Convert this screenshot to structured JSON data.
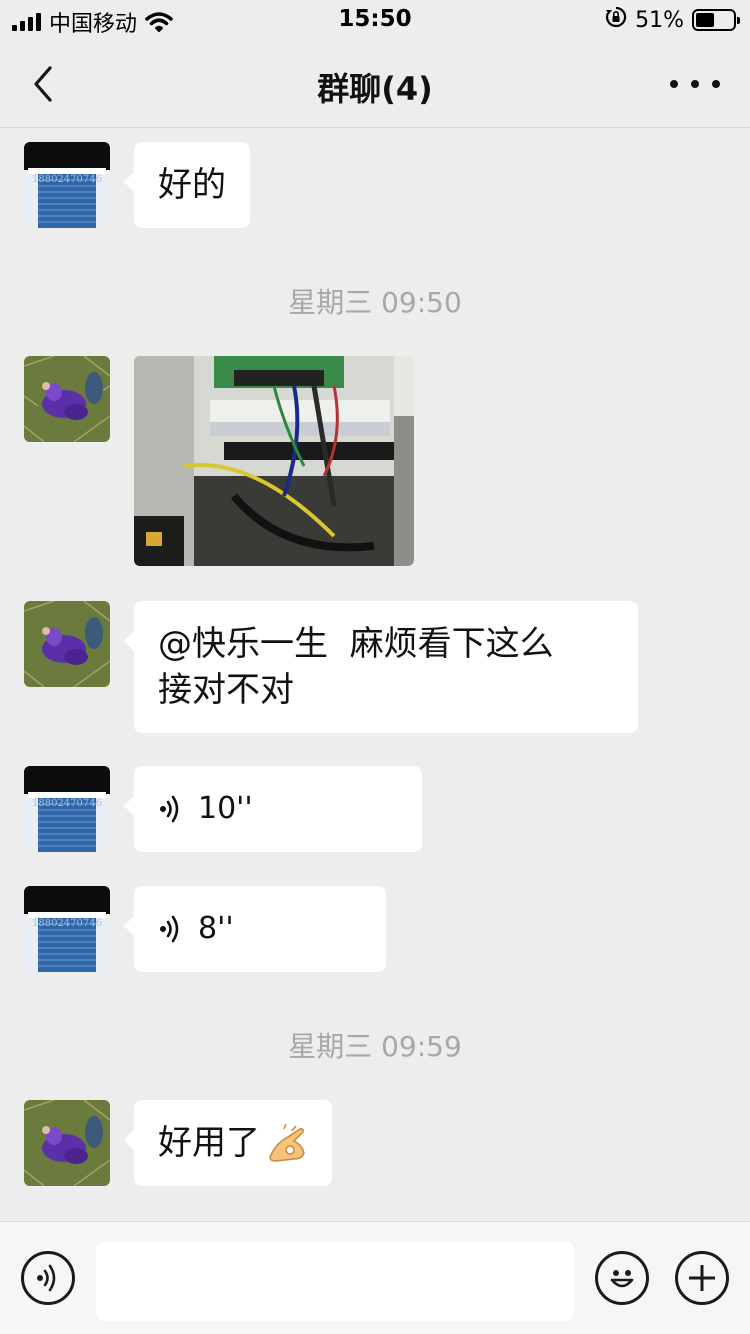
{
  "status_bar": {
    "carrier": "中国移动",
    "time": "15:50",
    "battery_percent": "51%",
    "battery_level": 0.51,
    "icons": [
      "signal-icon",
      "wifi-icon",
      "orientation-lock-icon",
      "battery-icon"
    ]
  },
  "nav": {
    "title": "群聊(4)",
    "back_icon": "chevron-left-icon",
    "more_icon": "more-dots-icon"
  },
  "messages": [
    {
      "type": "text",
      "sender_avatar": "door-avatar",
      "text": "好的"
    },
    {
      "type": "timestamp",
      "text": "星期三 09:50"
    },
    {
      "type": "image",
      "sender_avatar": "grass-avatar",
      "description": "electrical-panel-photo"
    },
    {
      "type": "text",
      "sender_avatar": "grass-avatar",
      "line1": "@快乐一生  麻烦看下这么",
      "line2": "接对不对"
    },
    {
      "type": "voice",
      "sender_avatar": "door-avatar",
      "duration": "10''"
    },
    {
      "type": "voice",
      "sender_avatar": "door-avatar",
      "duration": "8''"
    },
    {
      "type": "timestamp",
      "text": "星期三 09:59"
    },
    {
      "type": "text",
      "sender_avatar": "grass-avatar",
      "text": "好用了",
      "emoji": "ok-hand-emoji"
    }
  ],
  "avatar_texts": {
    "door_avatar_number": "18802470746"
  },
  "input_bar": {
    "value": "",
    "voice_icon": "voice-icon",
    "emoji_icon": "emoji-icon",
    "plus_icon": "plus-icon"
  },
  "colors": {
    "background": "#ededed",
    "bubble": "#ffffff",
    "timestamp": "#a8a8a8",
    "door_blue": "#2f66a8"
  }
}
